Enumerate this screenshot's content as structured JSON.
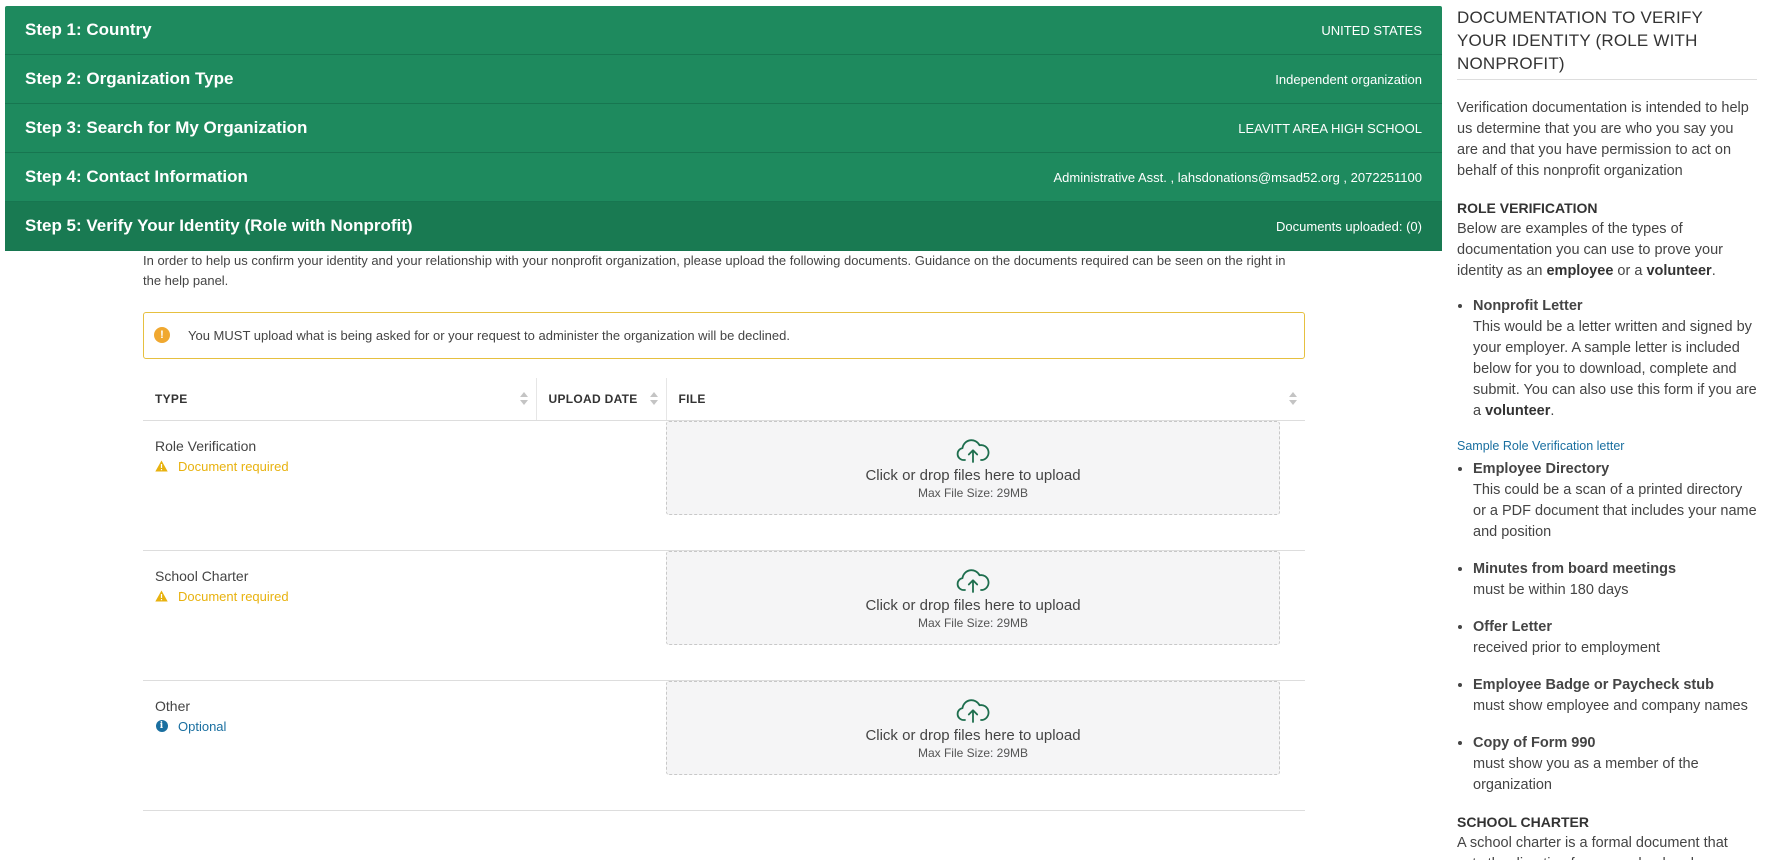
{
  "steps": [
    {
      "title": "Step 1: Country",
      "value": "UNITED STATES"
    },
    {
      "title": "Step 2: Organization Type",
      "value": "Independent organization"
    },
    {
      "title": "Step 3: Search for My Organization",
      "value": "LEAVITT AREA HIGH SCHOOL"
    },
    {
      "title": "Step 4: Contact Information",
      "value": "Administrative Asst. , lahsdonations@msad52.org , 2072251100"
    },
    {
      "title": "Step 5: Verify Your Identity (Role with Nonprofit)",
      "value": "Documents uploaded: (0)"
    }
  ],
  "intro": "In order to help us confirm your identity and your relationship with your nonprofit organization, please upload the following documents. Guidance on the documents required can be seen on the right in the help panel.",
  "alert": {
    "icon": "exclamation-icon",
    "text": "You MUST upload what is being asked for or your request to administer the organization will be declined.",
    "color": "#e6c040"
  },
  "table": {
    "headers": {
      "type": "TYPE",
      "upload_date": "UPLOAD DATE",
      "file": "FILE"
    },
    "rows": [
      {
        "name": "Role Verification",
        "status": "Document required",
        "upload_date": "",
        "drop_text": "Click or drop files here to upload",
        "max_size": "Max File Size: 29MB"
      },
      {
        "name": "School Charter",
        "status": "Document required",
        "upload_date": "",
        "drop_text": "Click or drop files here to upload",
        "max_size": "Max File Size: 29MB"
      },
      {
        "name": "Other",
        "status": "Optional",
        "upload_date": "",
        "drop_text": "Click or drop files here to upload",
        "max_size": "Max File Size: 29MB"
      }
    ]
  },
  "help": {
    "title": "DOCUMENTATION TO VERIFY YOUR IDENTITY (ROLE WITH NONPROFIT)",
    "intro": "Verification documentation is intended to help us determine that you are who you say you are and that you have permission to act on behalf of this nonprofit organization",
    "role_heading": "ROLE VERIFICATION",
    "role_p1": "Below are examples of the types of documentation you can use to prove your identity as an ",
    "role_employee": "employee",
    "role_or": " or a ",
    "role_volunteer": "volunteer",
    "role_period": ".",
    "nonprofit_letter": {
      "title": "Nonprofit Letter",
      "desc": "This would be a letter written and signed by your employer. A sample letter is included below for you to download, complete and submit. You can also use this form if you are a ",
      "volunteer": "volunteer",
      "period": "."
    },
    "sample_link": "Sample Role Verification letter",
    "items": [
      {
        "title": "Employee Directory",
        "desc": "This could be a scan of a printed directory or a PDF document that includes your name and position"
      },
      {
        "title": "Minutes from board meetings",
        "desc": "must be within 180 days"
      },
      {
        "title": "Offer Letter",
        "desc": "received prior to employment"
      },
      {
        "title": "Employee Badge or Paycheck stub",
        "desc": "must show employee and company names"
      },
      {
        "title": "Copy of Form 990",
        "desc": "must show you as a member of the organization"
      }
    ],
    "charter_heading": "SCHOOL CHARTER",
    "charter_p": "A school charter is a formal document that sets the direction for your school and"
  },
  "colors": {
    "step_bg": "#1e8a5e",
    "step_active_bg": "#197a52",
    "required": "#e8b20f",
    "optional": "#1a6fa0",
    "upload_icon": "#1e6e4e"
  }
}
